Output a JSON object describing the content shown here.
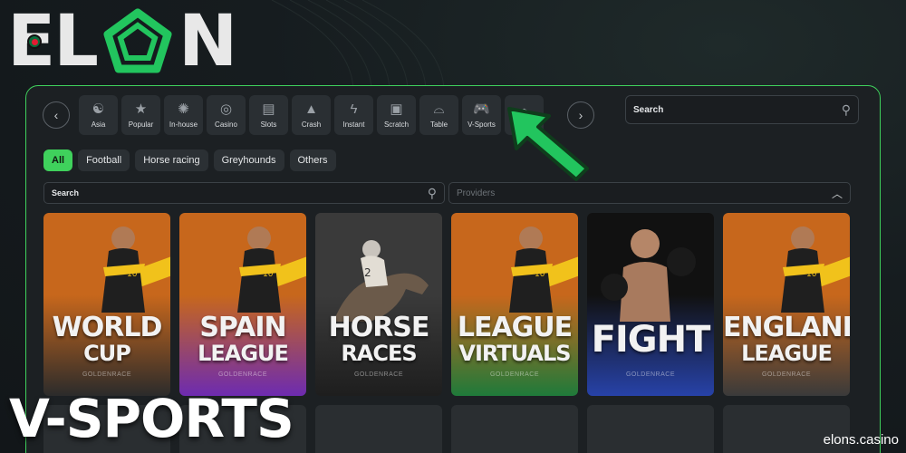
{
  "brand": {
    "letters_left": "EL",
    "letter_right": "N"
  },
  "categories": [
    {
      "label": "Asia",
      "icon": "yin-yang-icon",
      "glyph": "☯"
    },
    {
      "label": "Popular",
      "icon": "star-icon",
      "glyph": "★"
    },
    {
      "label": "In-house",
      "icon": "in-house-icon",
      "glyph": "✺"
    },
    {
      "label": "Casino",
      "icon": "chip-icon",
      "glyph": "◎"
    },
    {
      "label": "Slots",
      "icon": "slot-machine-icon",
      "glyph": "▤"
    },
    {
      "label": "Crash",
      "icon": "rocket-icon",
      "glyph": "▲"
    },
    {
      "label": "Instant",
      "icon": "lightning-icon",
      "glyph": "ϟ"
    },
    {
      "label": "Scratch",
      "icon": "ticket-icon",
      "glyph": "▣"
    },
    {
      "label": "Table",
      "icon": "roulette-icon",
      "glyph": "⌓"
    },
    {
      "label": "V-Sports",
      "icon": "gamepad-icon",
      "glyph": "🎮"
    },
    {
      "label": "",
      "icon": "dice-icon",
      "glyph": "⬢"
    }
  ],
  "active_category": "V-Sports",
  "top_search": {
    "label": "Search"
  },
  "filters": [
    "All",
    "Football",
    "Horse racing",
    "Greyhounds",
    "Others"
  ],
  "active_filter": "All",
  "game_search": {
    "label": "Search"
  },
  "providers": {
    "placeholder": "Providers"
  },
  "games": [
    {
      "line1": "WORLD",
      "line2": "CUP",
      "provider": "GOLDENRACE",
      "bg": "#c7671c",
      "bg2": "#2b2b2b",
      "kind": "footballer"
    },
    {
      "line1": "SPAIN",
      "line2": "LEAGUE",
      "provider": "GOLDENRACE",
      "bg": "#c7671c",
      "bg2": "#6d2bb0",
      "kind": "footballer"
    },
    {
      "line1": "HORSE",
      "line2": "RACES",
      "provider": "GOLDENRACE",
      "bg": "#3a3a3a",
      "bg2": "#1e1e1e",
      "kind": "horse"
    },
    {
      "line1": "LEAGUE",
      "line2": "VIRTUALS",
      "provider": "GOLDENRACE",
      "bg": "#c7671c",
      "bg2": "#1f7a3a",
      "kind": "footballer"
    },
    {
      "line1": "FIGHT",
      "line2": "",
      "provider": "GOLDENRACE",
      "bg": "#111111",
      "bg2": "#2742a8",
      "kind": "fighter"
    },
    {
      "line1": "ENGLAND",
      "line2": "LEAGUE",
      "provider": "GOLDENRACE",
      "bg": "#c7671c",
      "bg2": "#3a3a3a",
      "kind": "footballer"
    }
  ],
  "caption": "V-SPORTS",
  "watermark": "elons.casino",
  "colors": {
    "accent": "#3fd15c",
    "panel": "#1c2023"
  }
}
